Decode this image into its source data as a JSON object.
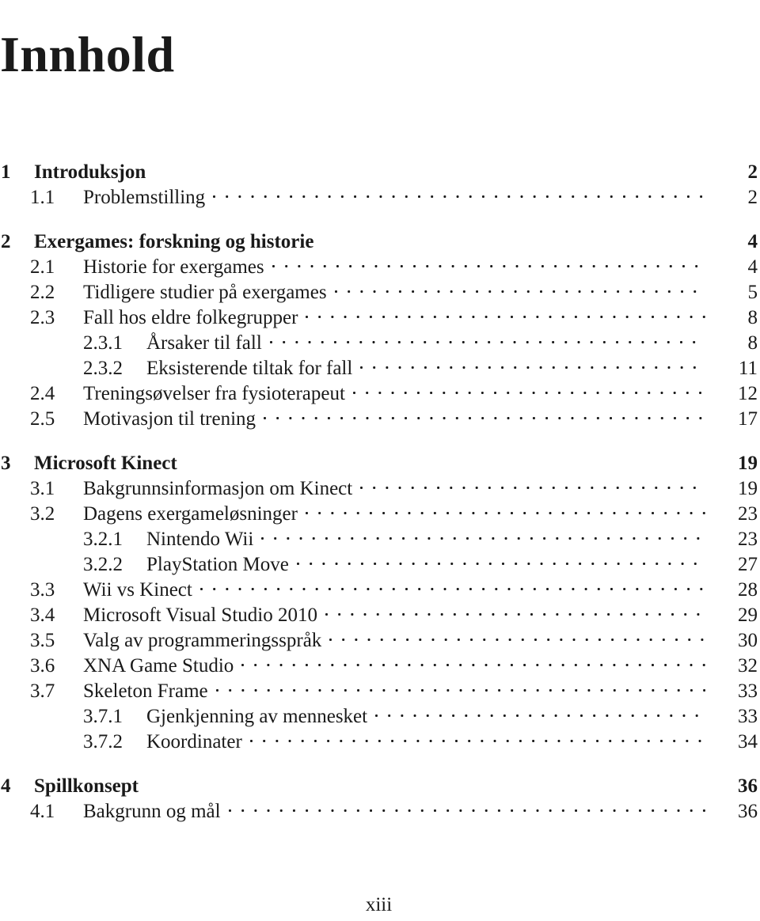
{
  "document": {
    "title": "Innhold",
    "folio": "xiii"
  },
  "toc": {
    "entries": [
      {
        "level": "chapter",
        "number": "1",
        "label": "Introduksjon",
        "page": "2"
      },
      {
        "level": "section",
        "number": "1.1",
        "label": "Problemstilling",
        "page": "2"
      },
      {
        "level": "chapter",
        "number": "2",
        "label": "Exergames: forskning og historie",
        "page": "4"
      },
      {
        "level": "section",
        "number": "2.1",
        "label": "Historie for exergames",
        "page": "4"
      },
      {
        "level": "section",
        "number": "2.2",
        "label": "Tidligere studier på exergames",
        "page": "5"
      },
      {
        "level": "section",
        "number": "2.3",
        "label": "Fall hos eldre folkegrupper",
        "page": "8"
      },
      {
        "level": "subsection",
        "number": "2.3.1",
        "label": "Årsaker til fall",
        "page": "8"
      },
      {
        "level": "subsection",
        "number": "2.3.2",
        "label": "Eksisterende tiltak for fall",
        "page": "11"
      },
      {
        "level": "section",
        "number": "2.4",
        "label": "Treningsøvelser fra fysioterapeut",
        "page": "12"
      },
      {
        "level": "section",
        "number": "2.5",
        "label": "Motivasjon til trening",
        "page": "17"
      },
      {
        "level": "chapter",
        "number": "3",
        "label": "Microsoft Kinect",
        "page": "19"
      },
      {
        "level": "section",
        "number": "3.1",
        "label": "Bakgrunnsinformasjon om Kinect",
        "page": "19"
      },
      {
        "level": "section",
        "number": "3.2",
        "label": "Dagens exergameløsninger",
        "page": "23"
      },
      {
        "level": "subsection",
        "number": "3.2.1",
        "label": "Nintendo Wii",
        "page": "23"
      },
      {
        "level": "subsection",
        "number": "3.2.2",
        "label": "PlayStation Move",
        "page": "27"
      },
      {
        "level": "section",
        "number": "3.3",
        "label": "Wii vs Kinect",
        "page": "28"
      },
      {
        "level": "section",
        "number": "3.4",
        "label": "Microsoft Visual Studio 2010",
        "page": "29"
      },
      {
        "level": "section",
        "number": "3.5",
        "label": "Valg av programmeringsspråk",
        "page": "30"
      },
      {
        "level": "section",
        "number": "3.6",
        "label": "XNA Game Studio",
        "page": "32"
      },
      {
        "level": "section",
        "number": "3.7",
        "label": "Skeleton Frame",
        "page": "33"
      },
      {
        "level": "subsection",
        "number": "3.7.1",
        "label": "Gjenkjenning av mennesket",
        "page": "33"
      },
      {
        "level": "subsection",
        "number": "3.7.2",
        "label": "Koordinater",
        "page": "34"
      },
      {
        "level": "chapter",
        "number": "4",
        "label": "Spillkonsept",
        "page": "36"
      },
      {
        "level": "section",
        "number": "4.1",
        "label": "Bakgrunn og mål",
        "page": "36"
      }
    ]
  }
}
